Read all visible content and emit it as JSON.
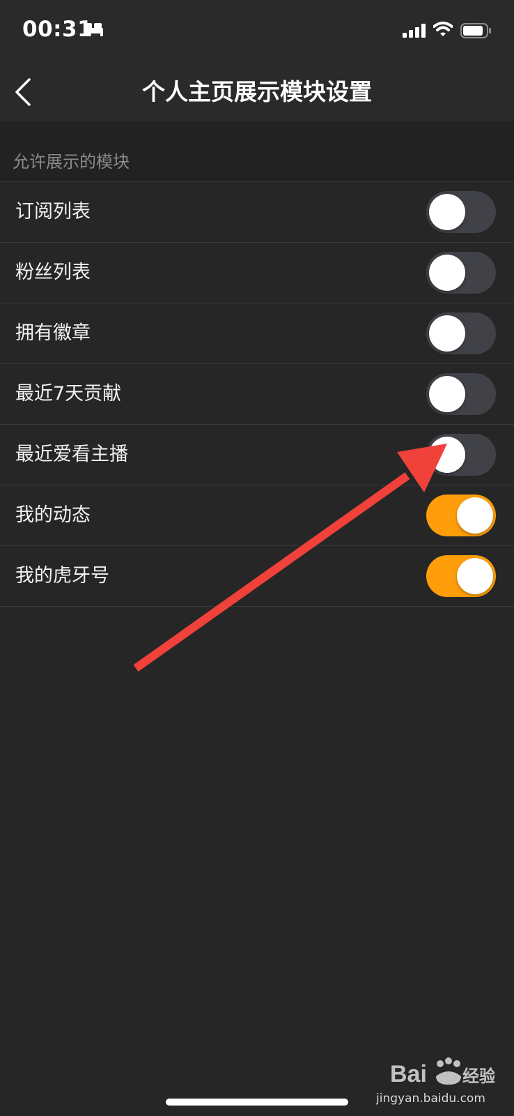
{
  "status_bar": {
    "time": "00:31"
  },
  "nav": {
    "title": "个人主页展示模块设置"
  },
  "section": {
    "label": "允许展示的模块"
  },
  "settings": [
    {
      "label": "订阅列表",
      "enabled": false
    },
    {
      "label": "粉丝列表",
      "enabled": false
    },
    {
      "label": "拥有徽章",
      "enabled": false
    },
    {
      "label": "最近7天贡献",
      "enabled": false
    },
    {
      "label": "最近爱看主播",
      "enabled": false
    },
    {
      "label": "我的动态",
      "enabled": true
    },
    {
      "label": "我的虎牙号",
      "enabled": true
    }
  ],
  "watermark": {
    "brand": "Baidu经验",
    "url": "jingyan.baidu.com"
  },
  "colors": {
    "background": "#262626",
    "toggle_on": "#ff9e0a",
    "toggle_off": "#414148",
    "annotation_arrow": "#f0413a"
  }
}
